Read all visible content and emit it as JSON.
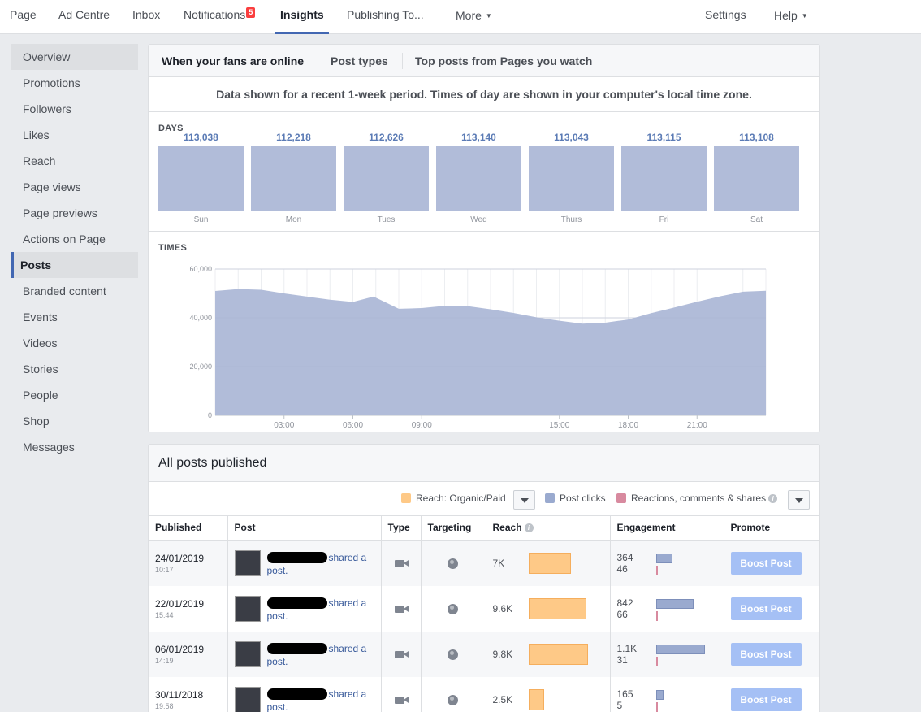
{
  "topnav": {
    "items": [
      {
        "label": "Page"
      },
      {
        "label": "Ad Centre"
      },
      {
        "label": "Inbox"
      },
      {
        "label": "Notifications",
        "badge": "5"
      },
      {
        "label": "Insights"
      },
      {
        "label": "Publishing To..."
      },
      {
        "label": "More"
      },
      {
        "label": "Settings"
      },
      {
        "label": "Help"
      }
    ]
  },
  "sidebar": {
    "items": [
      {
        "label": "Overview"
      },
      {
        "label": "Promotions"
      },
      {
        "label": "Followers"
      },
      {
        "label": "Likes"
      },
      {
        "label": "Reach"
      },
      {
        "label": "Page views"
      },
      {
        "label": "Page previews"
      },
      {
        "label": "Actions on Page"
      },
      {
        "label": "Posts"
      },
      {
        "label": "Branded content"
      },
      {
        "label": "Events"
      },
      {
        "label": "Videos"
      },
      {
        "label": "Stories"
      },
      {
        "label": "People"
      },
      {
        "label": "Shop"
      },
      {
        "label": "Messages"
      }
    ]
  },
  "insights": {
    "tabs": [
      {
        "label": "When your fans are online"
      },
      {
        "label": "Post types"
      },
      {
        "label": "Top posts from Pages you watch"
      }
    ],
    "notice": "Data shown for a recent 1-week period. Times of day are shown in your computer's local time zone.",
    "days_label": "DAYS",
    "times_label": "TIMES"
  },
  "chart_data": [
    {
      "type": "bar",
      "title": "DAYS",
      "categories": [
        "Sun",
        "Mon",
        "Tues",
        "Wed",
        "Thurs",
        "Fri",
        "Sat"
      ],
      "values": [
        113038,
        112218,
        112626,
        113140,
        113043,
        113115,
        113108
      ],
      "value_labels": [
        "113,038",
        "112,218",
        "112,626",
        "113,140",
        "113,043",
        "113,115",
        "113,108"
      ],
      "color": "#b1bcd9"
    },
    {
      "type": "area",
      "title": "TIMES",
      "x_tick_labels": [
        "03:00",
        "06:00",
        "09:00",
        "15:00",
        "18:00",
        "21:00"
      ],
      "x_ticks": [
        3,
        6,
        9,
        15,
        18,
        21
      ],
      "y_tick_labels": [
        "60,000",
        "40,000",
        "20,000",
        "0"
      ],
      "y_ticks": [
        60000,
        40000,
        20000,
        0
      ],
      "ylim": [
        0,
        60000
      ],
      "xlim": [
        0,
        24
      ],
      "grid": true,
      "x": [
        0,
        1,
        2,
        3,
        4,
        5,
        6,
        6.9,
        7.5,
        8,
        9,
        10,
        11,
        12,
        13,
        14,
        15,
        16,
        17,
        18,
        19,
        20,
        21,
        22,
        23,
        24
      ],
      "values": [
        51000,
        51800,
        51500,
        50000,
        48700,
        47400,
        46500,
        48700,
        46000,
        43700,
        44000,
        44900,
        44800,
        43500,
        42000,
        40200,
        38800,
        37600,
        38000,
        39300,
        41900,
        44200,
        46600,
        48800,
        50700,
        51100
      ],
      "color": "#b1bcd9"
    }
  ],
  "posts": {
    "title": "All posts published",
    "legend": [
      {
        "label": "Reach: Organic/Paid",
        "color": "#fec987"
      },
      {
        "label": "Post clicks",
        "color": "#9aaacf"
      },
      {
        "label": "Reactions, comments & shares",
        "color": "#d88a9f"
      }
    ],
    "columns": [
      "Published",
      "Post",
      "Type",
      "Targeting",
      "Reach",
      "Engagement",
      "Promote"
    ],
    "rows": [
      {
        "date": "24/01/2019",
        "time": "10:17",
        "text_a": "shared a",
        "text_b": "post.",
        "reach": "7K",
        "reach_value": 7000,
        "eng1": "364",
        "eng2": "46",
        "eng1_value": 364,
        "boost": "Boost Post"
      },
      {
        "date": "22/01/2019",
        "time": "15:44",
        "text_a": "shared a",
        "text_b": "post.",
        "reach": "9.6K",
        "reach_value": 9600,
        "eng1": "842",
        "eng2": "66",
        "eng1_value": 842,
        "boost": "Boost Post"
      },
      {
        "date": "06/01/2019",
        "time": "14:19",
        "text_a": "shared a",
        "text_b": "post.",
        "reach": "9.8K",
        "reach_value": 9800,
        "eng1": "1.1K",
        "eng2": "31",
        "eng1_value": 1100,
        "boost": "Boost Post"
      },
      {
        "date": "30/11/2018",
        "time": "19:58",
        "text_a": "shared a",
        "text_b": "post.",
        "reach": "2.5K",
        "reach_value": 2500,
        "eng1": "165",
        "eng2": "5",
        "eng1_value": 165,
        "boost": "Boost Post"
      }
    ]
  }
}
